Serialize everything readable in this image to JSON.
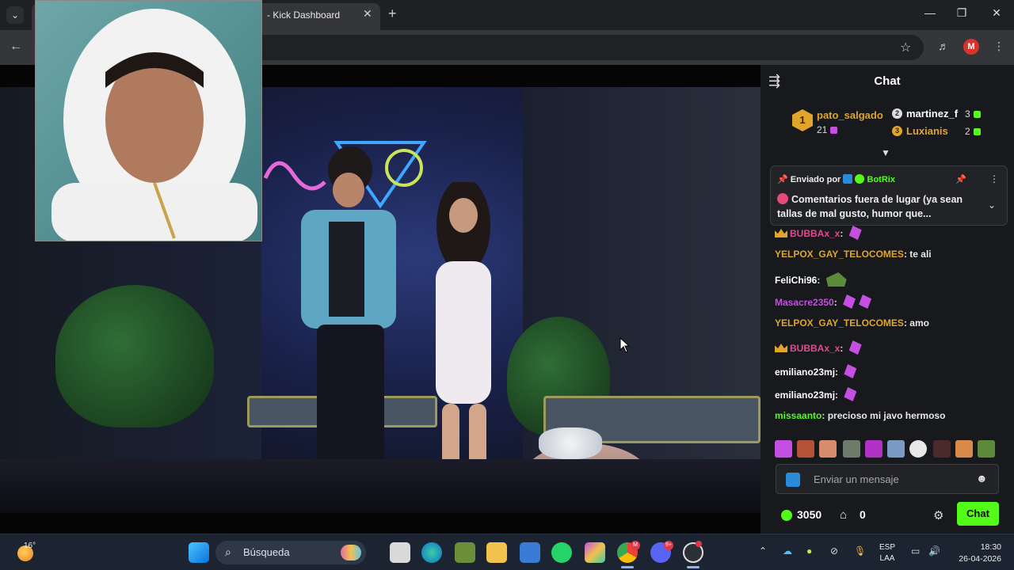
{
  "browser": {
    "tab_title": "- Kick Dashboard",
    "menu_glyph": "⌄",
    "close_glyph": "✕",
    "new_tab_glyph": "+",
    "minimize_glyph": "—",
    "maximize_glyph": "❐",
    "window_close_glyph": "✕",
    "back_glyph": "←",
    "star_glyph": "☆",
    "profile_initial": "M",
    "more_glyph": "⋮",
    "media_glyph": "♬"
  },
  "chat": {
    "title": "Chat",
    "collapse_glyph": "⇶",
    "leaderboard": {
      "first": {
        "rank": "1",
        "name": "pato_salgado",
        "count": "21",
        "color": "#e0a52a"
      },
      "second": {
        "rank": "2",
        "name": "martinez_f",
        "count": "3",
        "color": "#ffffff"
      },
      "third": {
        "rank": "3",
        "name": "Luxianis",
        "count": "2",
        "color": "#e0a52a"
      }
    },
    "pinned": {
      "label": "Enviado por",
      "author": "BotRix",
      "message": "Comentarios fuera de lugar (ya sean tallas de mal gusto, humor que..."
    },
    "messages": [
      {
        "user": "BUBBAx_x",
        "text": "",
        "color": "#e04b8e",
        "crown": true,
        "emotes": 1
      },
      {
        "user": "YELPOX_GAY_TELOCOMES",
        "text": "te ali",
        "color": "#e0a52a",
        "crown": false,
        "emotes": 0
      },
      {
        "user": "FeliChi96",
        "text": "",
        "color": "#ffffff",
        "crown": false,
        "emotes": 0,
        "green_emote": true
      },
      {
        "user": "Masacre2350",
        "text": "",
        "color": "#c44fe0",
        "crown": false,
        "emotes": 2
      },
      {
        "user": "YELPOX_GAY_TELOCOMES",
        "text": "amo",
        "color": "#e0a52a",
        "crown": false,
        "emotes": 0
      },
      {
        "user": "BUBBAx_x",
        "text": "",
        "color": "#e04b8e",
        "crown": true,
        "emotes": 1
      },
      {
        "user": "emiliano23mj",
        "text": "",
        "color": "#ffffff",
        "crown": false,
        "emotes": 1
      },
      {
        "user": "emiliano23mj",
        "text": "",
        "color": "#ffffff",
        "crown": false,
        "emotes": 1
      },
      {
        "user": "missaanto",
        "text": "precioso mi javo hermoso",
        "color": "#53fc18",
        "crown": false,
        "emotes": 0
      }
    ],
    "input_placeholder": "Enviar un mensaje",
    "points": "3050",
    "gifts": "0",
    "send_label": "Chat",
    "accent": "#53fc18"
  },
  "taskbar": {
    "temperature": "16°",
    "search_label": "Búsqueda",
    "language": "ESP",
    "keyboard": "LAA",
    "time": "18:30",
    "date": "26-04-2026",
    "discord_badge": "9+",
    "chrome_badge": "M"
  }
}
